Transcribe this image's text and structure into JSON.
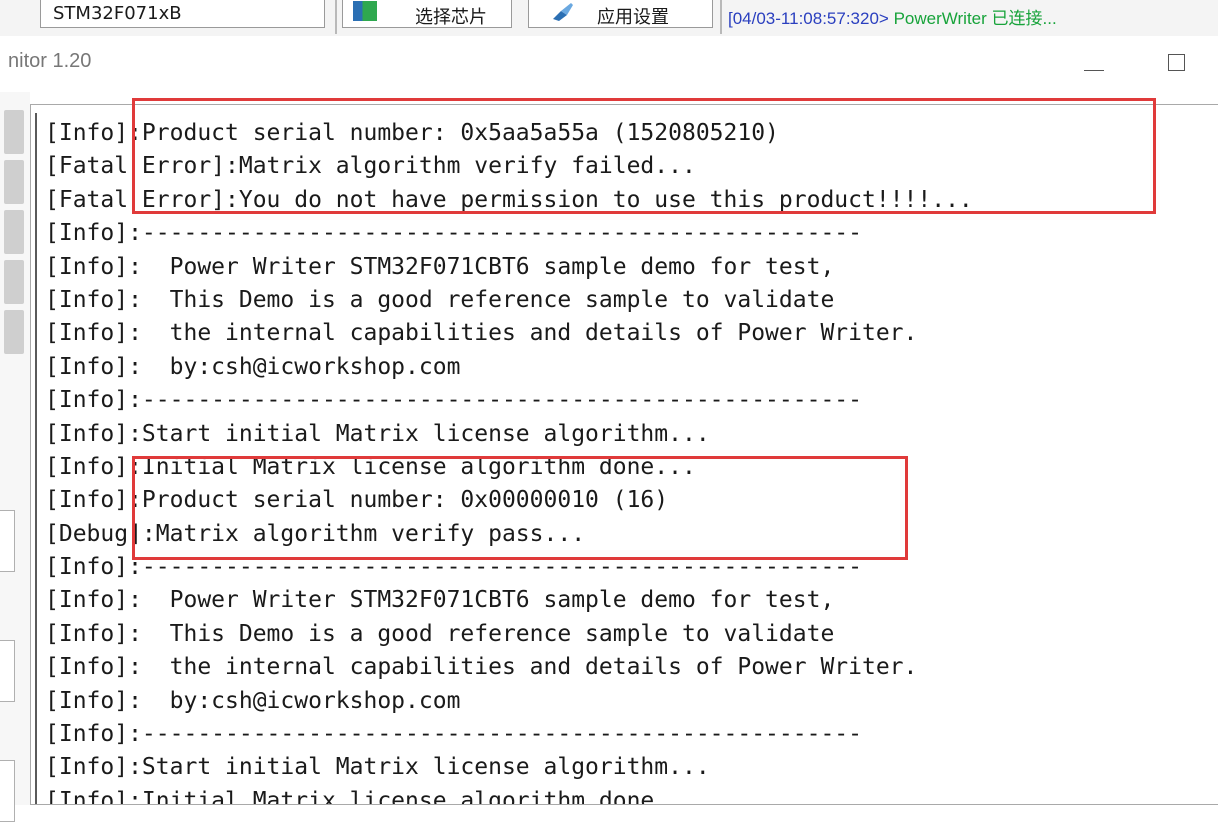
{
  "toolbar": {
    "device": "STM32F071xB",
    "select_chip": "选择芯片",
    "app_settings": "应用设置",
    "status_timestamp": "[04/03-11:08:57:320>",
    "status_message": " PowerWriter 已连接..."
  },
  "window": {
    "title": "nitor 1.20",
    "minimize_symbol": "—",
    "maximize_symbol": "☐"
  },
  "log": {
    "lines": [
      "[Info]:Product serial number: 0x5aa5a55a (1520805210)",
      "[Fatal Error]:Matrix algorithm verify failed...",
      "[Fatal Error]:You do not have permission to use this product!!!!...",
      "[Info]:----------------------------------------------------",
      "[Info]:  Power Writer STM32F071CBT6 sample demo for test,",
      "[Info]:  This Demo is a good reference sample to validate",
      "[Info]:  the internal capabilities and details of Power Writer.",
      "[Info]:  by:csh@icworkshop.com",
      "[Info]:----------------------------------------------------",
      "[Info]:Start initial Matrix license algorithm...",
      "[Info]:Initial Matrix license algorithm done...",
      "[Info]:Product serial number: 0x00000010 (16)",
      "[Debug]:Matrix algorithm verify pass...",
      "[Info]:----------------------------------------------------",
      "[Info]:  Power Writer STM32F071CBT6 sample demo for test,",
      "[Info]:  This Demo is a good reference sample to validate",
      "[Info]:  the internal capabilities and details of Power Writer.",
      "[Info]:  by:csh@icworkshop.com",
      "[Info]:----------------------------------------------------",
      "[Info]:Start initial Matrix license algorithm...",
      "[Info]:Initial Matrix license algorithm done..."
    ]
  },
  "colors": {
    "annotation": "#e03a3a",
    "status_timestamp": "#2a3fbf",
    "status_message": "#17a33a"
  }
}
